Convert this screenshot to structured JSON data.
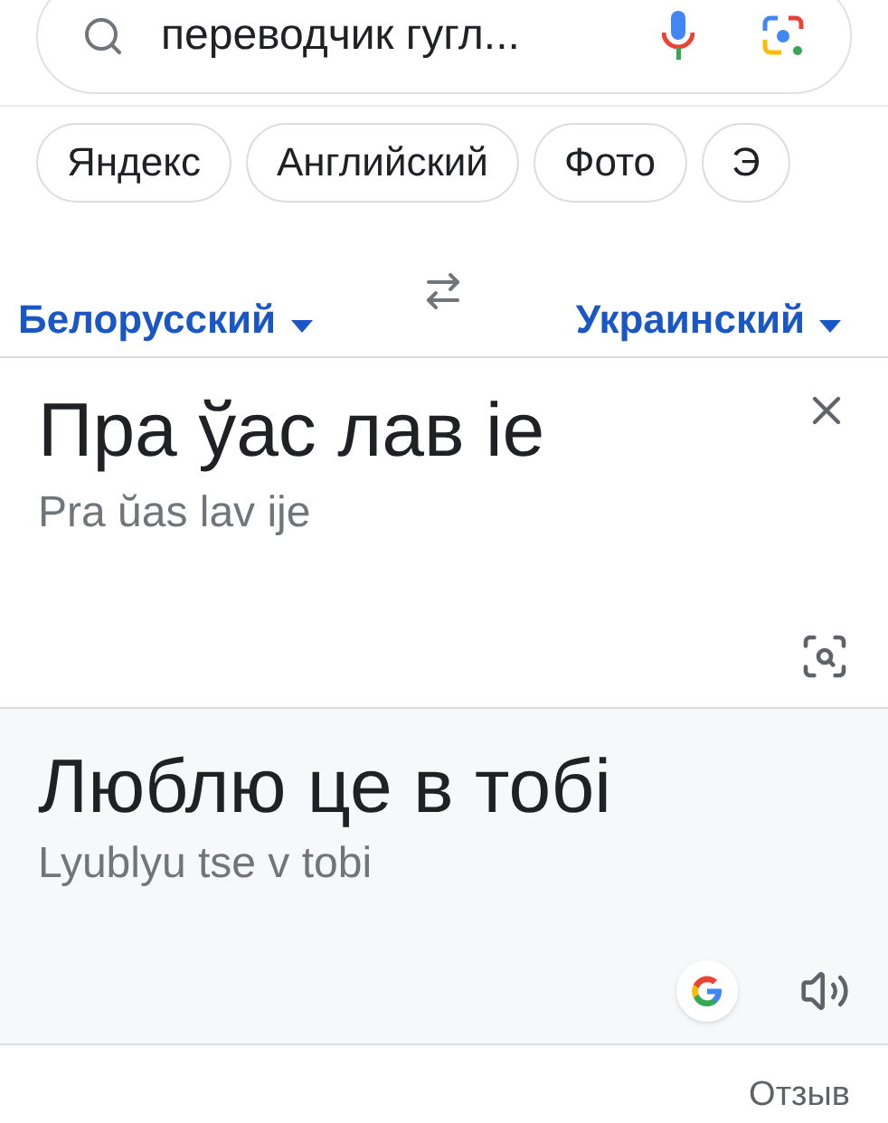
{
  "search": {
    "value": "переводчик гугл..."
  },
  "chips": [
    "Яндекс",
    "Английский",
    "Фото",
    "Э"
  ],
  "languages": {
    "source": "Белорусский",
    "target": "Украинский"
  },
  "source": {
    "text": "Пра ўас лав іе",
    "transliteration": "Pra ŭas lav ije"
  },
  "target": {
    "text": "Люблю це в тобі",
    "transliteration": "Lyublyu tse v tobi"
  },
  "feedback": "Отзыв"
}
